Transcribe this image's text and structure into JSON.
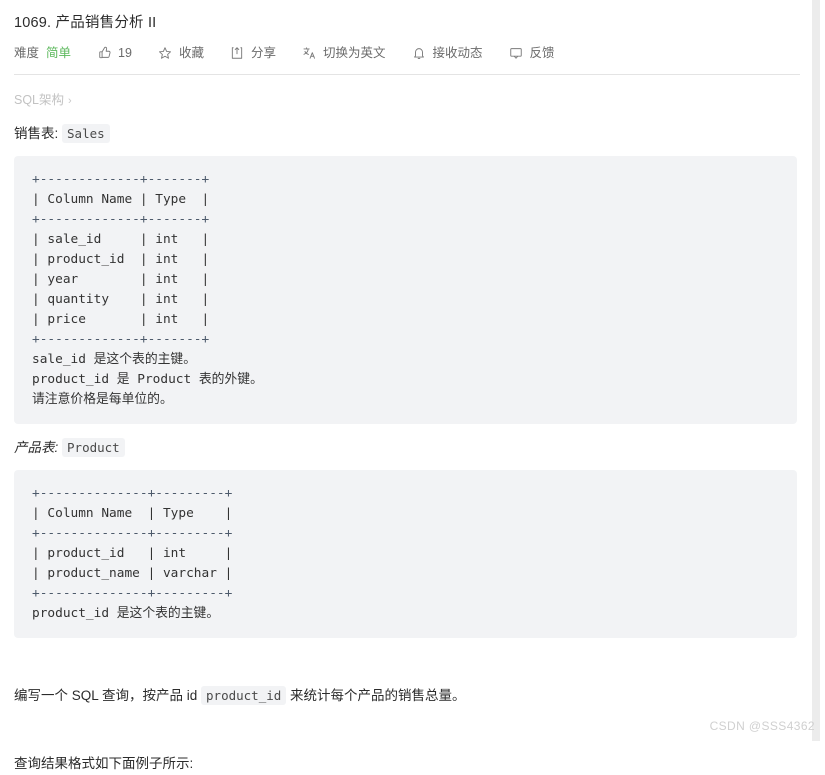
{
  "page": {
    "title": "1069. 产品销售分析 II",
    "watermark": "CSDN @SSS4362"
  },
  "toolbar": {
    "difficulty_label": "难度",
    "difficulty_value": "简单",
    "like_count": "19",
    "favorite_label": "收藏",
    "share_label": "分享",
    "translate_label": "切换为英文",
    "subscribe_label": "接收动态",
    "feedback_label": "反馈",
    "icons": {
      "like": "thumbs-up-icon",
      "favorite": "star-icon",
      "share": "share-icon",
      "translate": "translate-icon",
      "subscribe": "bell-icon",
      "feedback": "comment-icon"
    }
  },
  "breadcrumb": {
    "item": "SQL架构",
    "separator": "›"
  },
  "sales_table": {
    "caption_label": "销售表:",
    "caption_code": "Sales",
    "code_lines": [
      "+-------------+-------+",
      "| Column Name | Type  |",
      "+-------------+-------+",
      "| sale_id     | int   |",
      "| product_id  | int   |",
      "| year        | int   |",
      "| quantity    | int   |",
      "| price       | int   |",
      "+-------------+-------+",
      "sale_id 是这个表的主键。",
      "product_id 是 Product 表的外键。",
      "请注意价格是每单位的。"
    ]
  },
  "product_table": {
    "caption_label": "产品表:",
    "caption_code": "Product",
    "code_lines": [
      "+--------------+---------+",
      "| Column Name  | Type    |",
      "+--------------+---------+",
      "| product_id   | int     |",
      "| product_name | varchar |",
      "+--------------+---------+",
      "product_id 是这个表的主键。"
    ]
  },
  "body": {
    "task_prefix": "编写一个 SQL 查询，按产品 id ",
    "task_code": "product_id",
    "task_suffix": " 来统计每个产品的销售总量。",
    "result_text": "查询结果格式如下面例子所示:"
  }
}
